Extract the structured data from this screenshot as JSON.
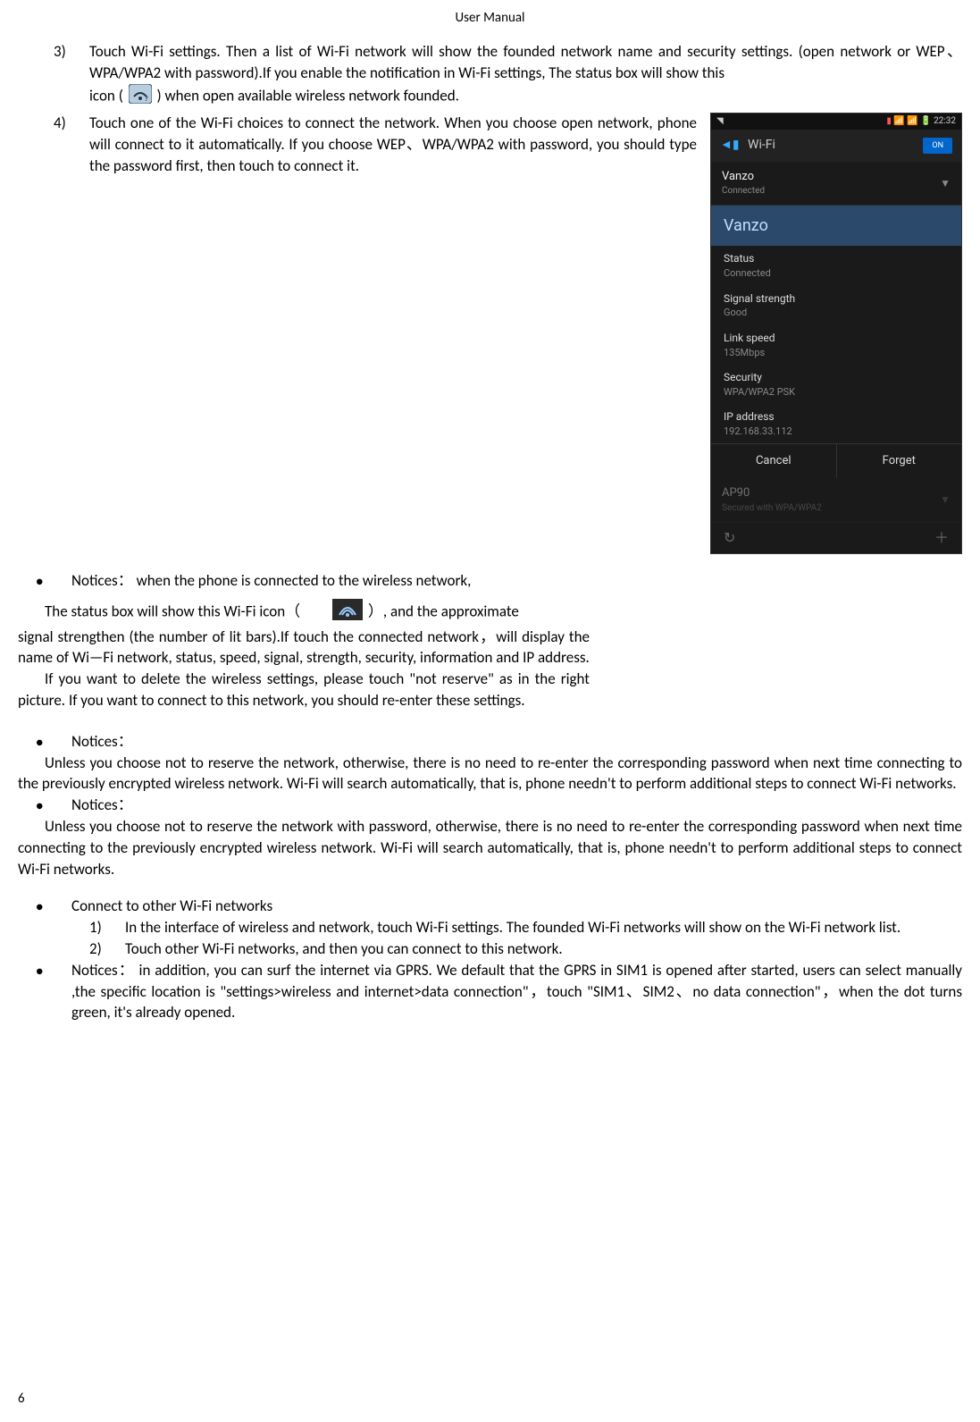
{
  "header": {
    "title": "User    Manual"
  },
  "pageNumber": "6",
  "items": {
    "i3": {
      "num": "3)",
      "text1": "Touch Wi-Fi settings. Then a list of Wi-Fi network will show the founded network name and security settings. (open network or WEP、WPA/WPA2 with password).If you enable the notification in    Wi-Fi settings, The status box will show this",
      "text2": "icon (",
      "text3": ") when open available wireless network founded."
    },
    "i4": {
      "num": "4)",
      "text": "Touch one of the Wi-Fi choices to connect the network. When you choose open network, phone will connect to it automatically. If you choose WEP、WPA/WPA2 with password, you should type the password first, then touch to connect it."
    }
  },
  "notices1": {
    "label": "Notices：",
    "text": "when the phone is connected to the wireless network,"
  },
  "para1a": "The status box will show this Wi-Fi icon（",
  "para1b": "）, and the approximate",
  "para2": "signal strengthen (the number of lit bars).If touch the connected network，will display the name of Wi—Fi    network, status, speed,    signal, strength, security, information and IP address.",
  "para3": "If you want to delete the wireless settings, please touch \"not reserve\" as in the right picture. If you want to connect to this network, you should re-enter these settings.",
  "notices2": {
    "label": "Notices：",
    "text": "Unless you choose not to reserve the network, otherwise, there is no need to re-enter the corresponding password when next time connecting to the previously encrypted wireless network. Wi-Fi will search automatically, that is, phone needn't to perform additional steps to connect Wi-Fi networks."
  },
  "notices3": {
    "label": "Notices：",
    "text": "Unless you choose not to reserve the network with password, otherwise, there is no need to re-enter the corresponding password when next time connecting to the previously encrypted wireless network. Wi-Fi will search automatically, that is, phone needn't to perform additional steps to connect Wi-Fi networks."
  },
  "connectOther": {
    "label": "Connect to other Wi-Fi networks",
    "s1n": "1)",
    "s1": "In the interface of wireless and network, touch Wi-Fi settings. The founded Wi-Fi networks will show on the Wi-Fi network list.",
    "s2n": "2)",
    "s2": "Touch other Wi-Fi networks, and then you can connect to this network."
  },
  "notices4": {
    "label": "Notices：",
    "text": "in addition, you can surf the internet via GPRS. We default that the GPRS in SIM1 is opened after started, users can select manually ,the specific location is  \"settings>wireless and internet>data connection\"，touch \"SIM1、SIM2、no data connection\"，when the dot turns green, it's already opened."
  },
  "screenshot": {
    "time": "22:32",
    "wifiLabel": "Wi-Fi",
    "onLabel": "ON",
    "net1": {
      "name": "Vanzo",
      "sub": "Connected"
    },
    "dialog": {
      "title": "Vanzo",
      "statusL": "Status",
      "statusV": "Connected",
      "signalL": "Signal strength",
      "signalV": "Good",
      "speedL": "Link speed",
      "speedV": "135Mbps",
      "secL": "Security",
      "secV": "WPA/WPA2 PSK",
      "ipL": "IP address",
      "ipV": "192.168.33.112",
      "cancel": "Cancel",
      "forget": "Forget"
    },
    "net2": {
      "name": "AP90",
      "sub": "Secured with WPA/WPA2"
    }
  }
}
